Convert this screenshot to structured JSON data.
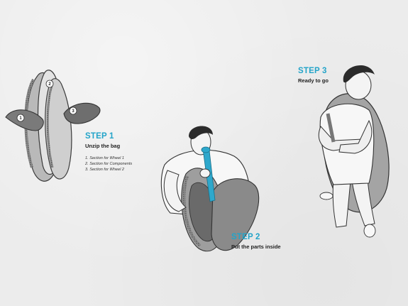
{
  "accent_color": "#23a4c9",
  "steps": [
    {
      "heading": "STEP 1",
      "description": "Unzip the bag",
      "sections": [
        "1. Section for Wheel 1",
        "2. Section for Components",
        "3. Section for Wheel 2"
      ]
    },
    {
      "heading": "STEP 2",
      "description": "Put the parts inside"
    },
    {
      "heading": "STEP 3",
      "description": "Ready to go"
    }
  ],
  "compartment_numbers": [
    "1",
    "2",
    "3"
  ]
}
